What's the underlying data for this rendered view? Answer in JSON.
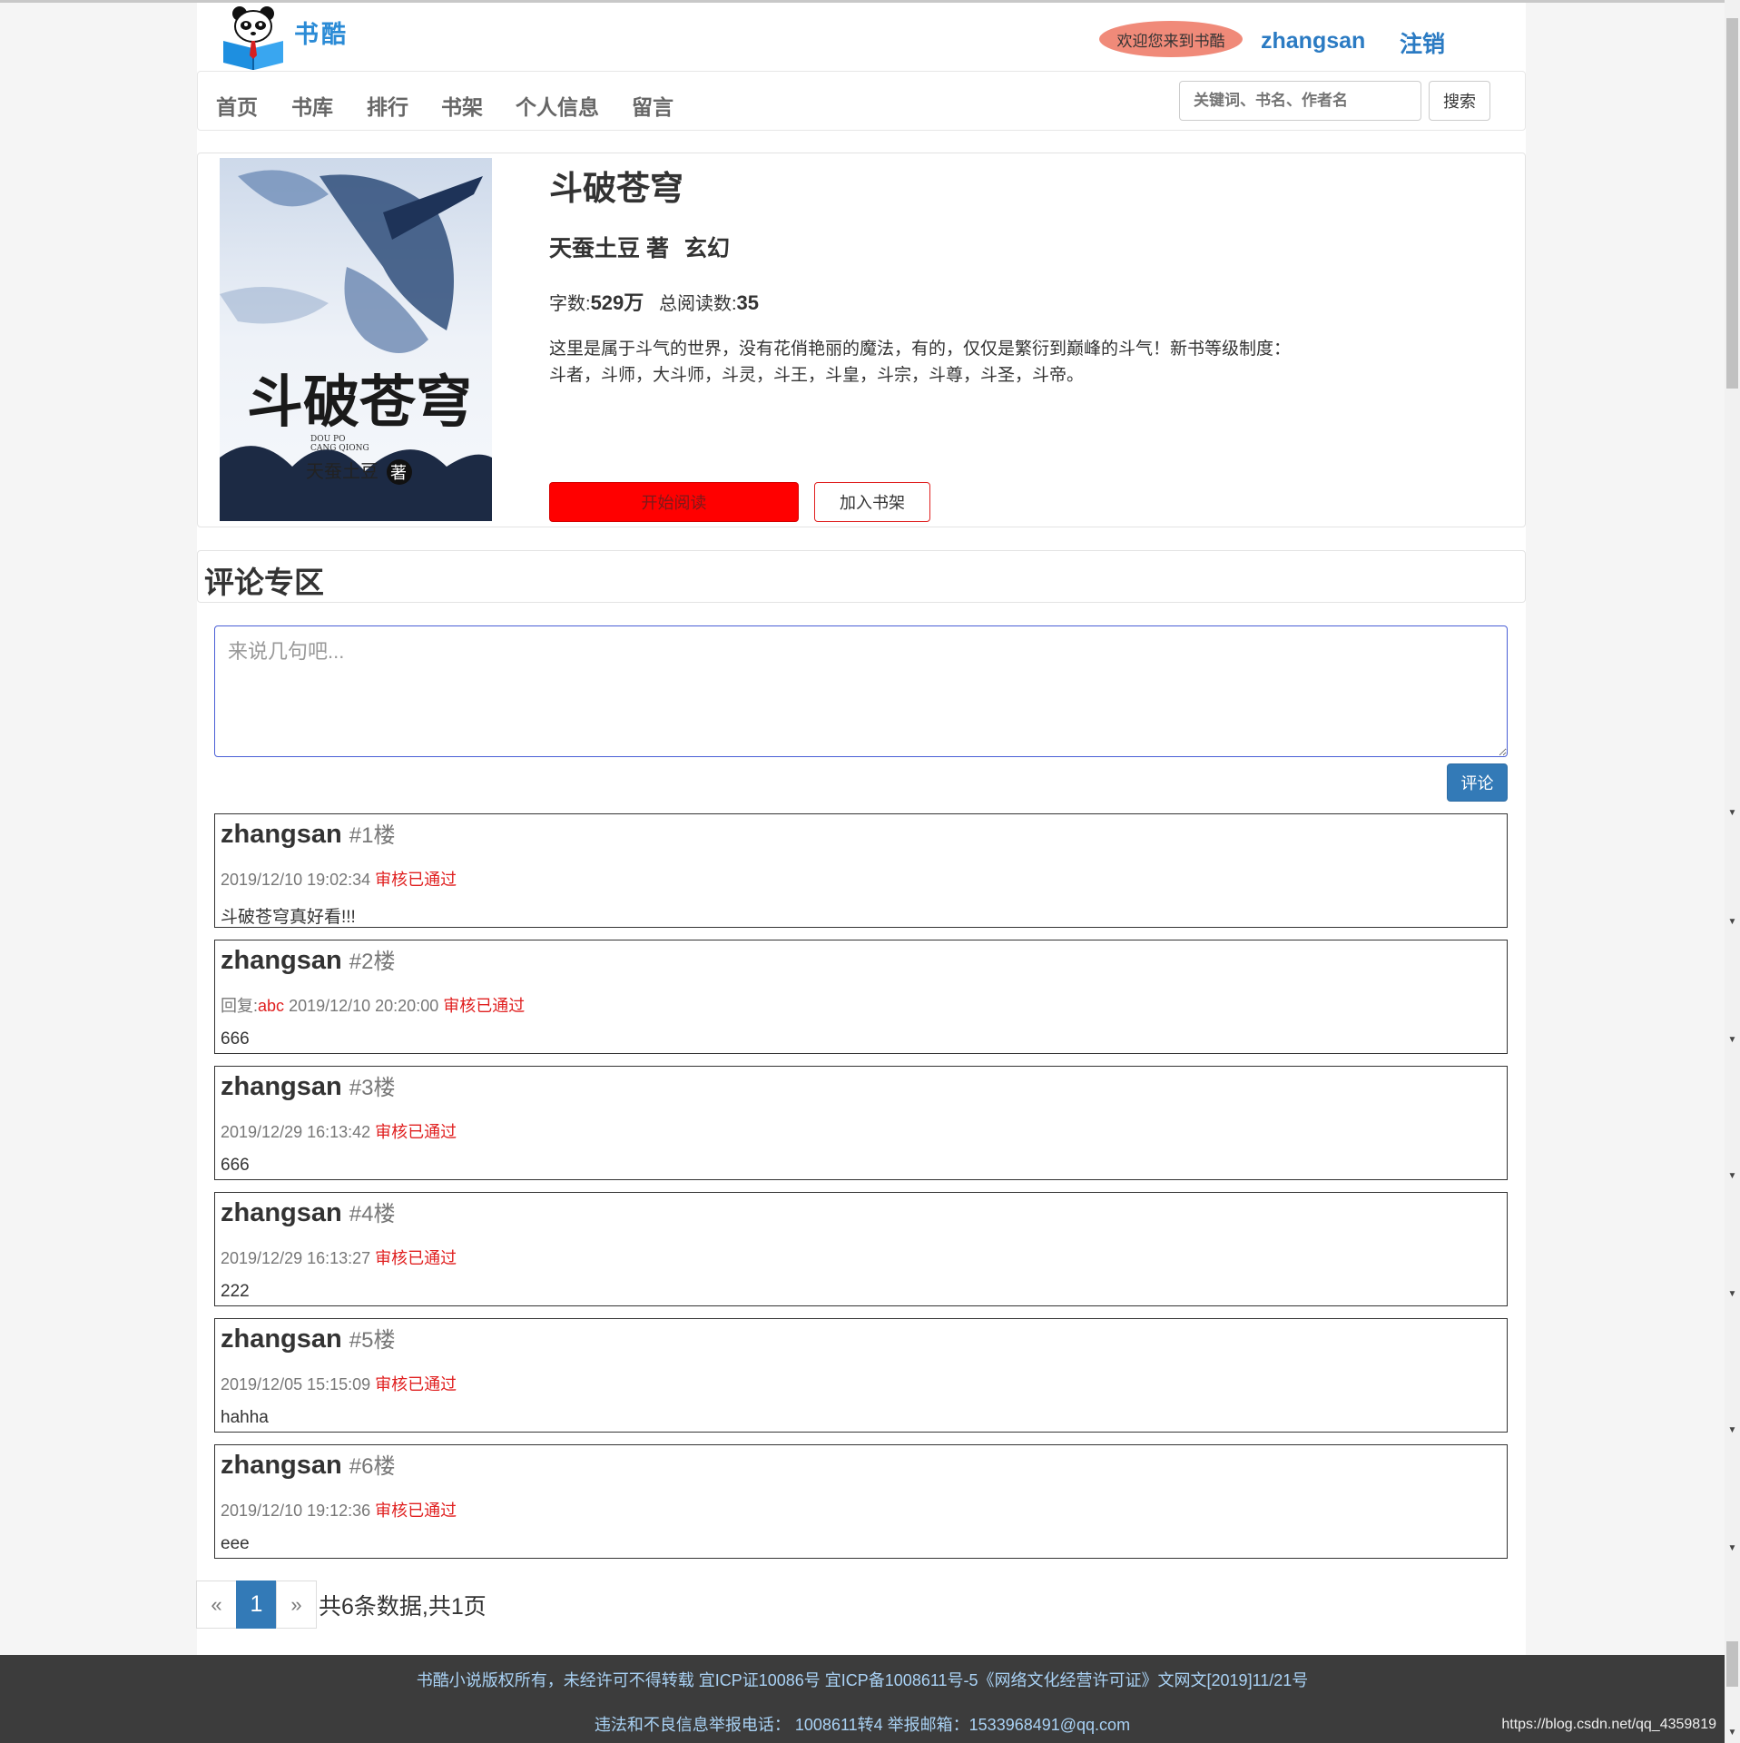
{
  "brand": {
    "name": "书酷"
  },
  "header": {
    "welcome": "欢迎您来到书酷",
    "username": "zhangsan",
    "logout": "注销"
  },
  "nav": {
    "items": [
      "首页",
      "书库",
      "排行",
      "书架",
      "个人信息",
      "留言"
    ],
    "search_placeholder": "关键词、书名、作者名",
    "search_button": "搜索"
  },
  "book": {
    "cover_title": "斗破苍穹",
    "cover_pinyin_1": "DOU PO",
    "cover_pinyin_2": "CANG QIONG",
    "cover_author": "天蚕土豆",
    "cover_badge": "著",
    "title": "斗破苍穹",
    "author": "天蚕土豆 著",
    "genre": "玄幻",
    "words_label": "字数:",
    "words_value": "529万",
    "reads_label": "总阅读数:",
    "reads_value": "35",
    "description": "这里是属于斗气的世界，没有花俏艳丽的魔法，有的，仅仅是繁衍到巅峰的斗气！新书等级制度：斗者，斗师，大斗师，斗灵，斗王，斗皇，斗宗，斗尊，斗圣，斗帝。",
    "read_button": "开始阅读",
    "shelf_button": "加入书架"
  },
  "comments_section": {
    "title": "评论专区",
    "placeholder": "来说几句吧...",
    "submit": "评论",
    "items": [
      {
        "user": "zhangsan",
        "floor": "#1楼",
        "reply_prefix": "",
        "reply_to": "",
        "time": "2019/12/10 19:02:34",
        "status": "审核已通过",
        "content": "斗破苍穹真好看!!!"
      },
      {
        "user": "zhangsan",
        "floor": "#2楼",
        "reply_prefix": "回复:",
        "reply_to": "abc",
        "time": "2019/12/10 20:20:00",
        "status": "审核已通过",
        "content": "666"
      },
      {
        "user": "zhangsan",
        "floor": "#3楼",
        "reply_prefix": "",
        "reply_to": "",
        "time": "2019/12/29 16:13:42",
        "status": "审核已通过",
        "content": "666"
      },
      {
        "user": "zhangsan",
        "floor": "#4楼",
        "reply_prefix": "",
        "reply_to": "",
        "time": "2019/12/29 16:13:27",
        "status": "审核已通过",
        "content": "222"
      },
      {
        "user": "zhangsan",
        "floor": "#5楼",
        "reply_prefix": "",
        "reply_to": "",
        "time": "2019/12/05 15:15:09",
        "status": "审核已通过",
        "content": "hahha"
      },
      {
        "user": "zhangsan",
        "floor": "#6楼",
        "reply_prefix": "",
        "reply_to": "",
        "time": "2019/12/10 19:12:36",
        "status": "审核已通过",
        "content": "eee"
      }
    ]
  },
  "pagination": {
    "prev": "«",
    "current": "1",
    "next": "»",
    "info": "共6条数据,共1页"
  },
  "footer": {
    "line1": "书酷小说版权所有，未经许可不得转载 宜ICP证10086号 宜ICP备1008611号-5《网络文化经营许可证》文网文[2019]11/21号",
    "line2": "违法和不良信息举报电话： 1008611转4 举报邮箱：1533968491@qq.com",
    "watermark": "https://blog.csdn.net/qq_4359819"
  },
  "colors": {
    "brand_blue": "#2b8bd6",
    "link_blue": "#337ab7",
    "welcome_bg": "#f08a79",
    "read_button": "#ff0000",
    "status_red": "#e02020",
    "footer_bg": "#3c3c3c"
  }
}
